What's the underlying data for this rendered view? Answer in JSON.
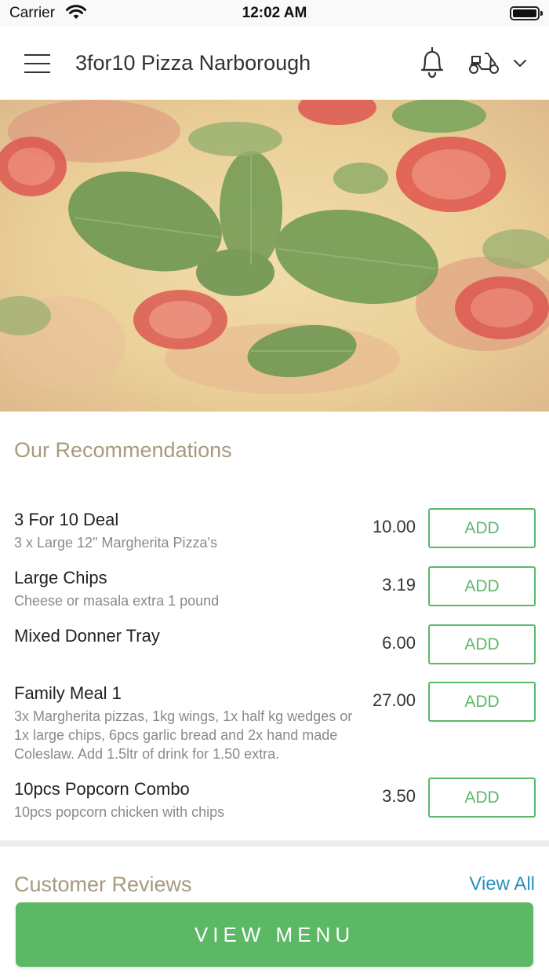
{
  "status_bar": {
    "carrier": "Carrier",
    "time": "12:02 AM"
  },
  "header": {
    "title": "3for10 Pizza Narborough",
    "icons": [
      "menu-icon",
      "bell-icon",
      "scooter-icon",
      "chevron-down-icon"
    ]
  },
  "recommendations": {
    "title": "Our Recommendations",
    "add_label": "ADD",
    "items": [
      {
        "name": "3 For 10 Deal",
        "description": "3 x Large 12\" Margherita Pizza's",
        "price": "10.00"
      },
      {
        "name": "Large Chips",
        "description": "Cheese or masala extra 1 pound",
        "price": "3.19"
      },
      {
        "name": "Mixed Donner Tray",
        "description": "",
        "price": "6.00"
      },
      {
        "name": "Family Meal 1",
        "description": "3x Margherita pizzas, 1kg wings, 1x half kg wedges or 1x large chips, 6pcs garlic bread and 2x hand made Coleslaw. Add 1.5ltr of drink for 1.50 extra.",
        "price": "27.00"
      },
      {
        "name": "10pcs Popcorn Combo",
        "description": "10pcs popcorn chicken with chips",
        "price": "3.50"
      }
    ]
  },
  "reviews": {
    "title": "Customer Reviews",
    "view_all": "View All"
  },
  "footer": {
    "view_menu": "VIEW MENU"
  },
  "colors": {
    "accent_green": "#5cb865",
    "heading_tan": "#a89a7e",
    "link_blue": "#2b8fbf"
  }
}
